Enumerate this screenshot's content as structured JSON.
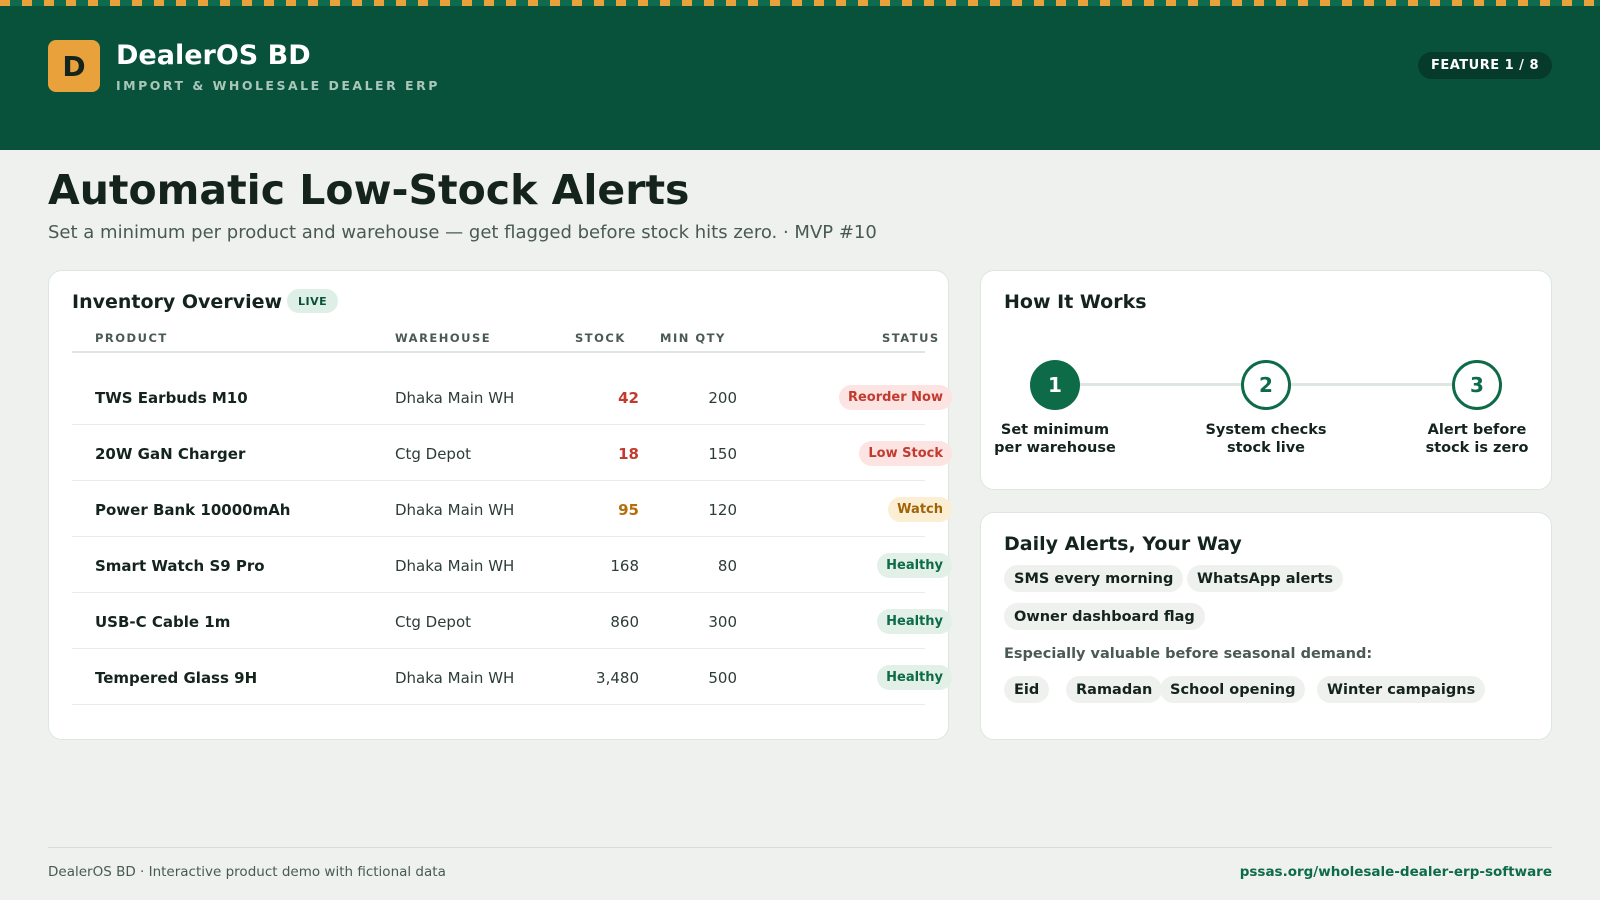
{
  "header": {
    "logo_letter": "D",
    "brand": "DealerOS BD",
    "tagline": "IMPORT & WHOLESALE DEALER ERP",
    "feature_badge": "FEATURE 1 / 8"
  },
  "page": {
    "title": "Automatic Low-Stock Alerts",
    "subtitle": "Set a minimum per product and warehouse — get flagged before stock hits zero. · MVP #10"
  },
  "inventory": {
    "title": "Inventory Overview",
    "live_badge": "LIVE",
    "columns": [
      "PRODUCT",
      "WAREHOUSE",
      "STOCK",
      "MIN QTY",
      "STATUS"
    ],
    "rows": [
      {
        "product": "TWS Earbuds M10",
        "warehouse": "Dhaka Main WH",
        "stock": "42",
        "min_qty": "200",
        "status": "Reorder Now"
      },
      {
        "product": "20W GaN Charger",
        "warehouse": "Ctg Depot",
        "stock": "18",
        "min_qty": "150",
        "status": "Low Stock"
      },
      {
        "product": "Power Bank 10000mAh",
        "warehouse": "Dhaka Main WH",
        "stock": "95",
        "min_qty": "120",
        "status": "Watch"
      },
      {
        "product": "Smart Watch S9 Pro",
        "warehouse": "Dhaka Main WH",
        "stock": "168",
        "min_qty": "80",
        "status": "Healthy"
      },
      {
        "product": "USB-C Cable 1m",
        "warehouse": "Ctg Depot",
        "stock": "860",
        "min_qty": "300",
        "status": "Healthy"
      },
      {
        "product": "Tempered Glass 9H",
        "warehouse": "Dhaka Main WH",
        "stock": "3,480",
        "min_qty": "500",
        "status": "Healthy"
      }
    ]
  },
  "how_it_works": {
    "title": "How It Works",
    "steps": [
      {
        "number": "1",
        "line1": "Set minimum",
        "line2": "per warehouse"
      },
      {
        "number": "2",
        "line1": "System checks",
        "line2": "stock live"
      },
      {
        "number": "3",
        "line1": "Alert before",
        "line2": "stock is zero"
      }
    ]
  },
  "daily_alerts": {
    "title": "Daily Alerts, Your Way",
    "channels": [
      "SMS every morning",
      "WhatsApp alerts",
      "Owner dashboard flag"
    ],
    "note": "Especially valuable before seasonal demand:",
    "seasons": [
      "Eid",
      "Ramadan",
      "School opening",
      "Winter campaigns"
    ]
  },
  "footer": {
    "left": "DealerOS BD · Interactive product demo with fictional data",
    "right": "pssas.org/wholesale-dealer-erp-software"
  },
  "colors": {
    "brand_green": "#08523b",
    "accent_amber": "#e9a23b",
    "alert_red": "#c23b2f",
    "watch_amber": "#a06408",
    "healthy_green": "#0d6b48"
  }
}
